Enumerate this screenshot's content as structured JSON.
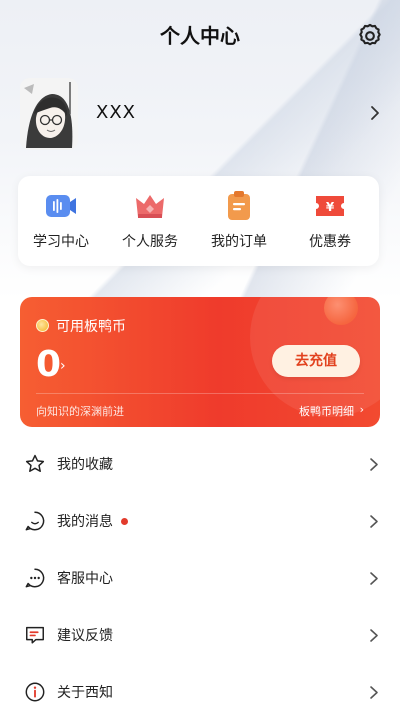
{
  "header": {
    "title": "个人中心",
    "settings_icon": "gear-icon"
  },
  "profile": {
    "username": "XXX",
    "avatar": "avatar-illustration"
  },
  "quick_actions": [
    {
      "label": "学习中心",
      "icon": "video-camera-icon",
      "color": "#5a8df0"
    },
    {
      "label": "个人服务",
      "icon": "crown-icon",
      "color": "#ec6a6a"
    },
    {
      "label": "我的订单",
      "icon": "clipboard-icon",
      "color": "#f29a4c"
    },
    {
      "label": "优惠券",
      "icon": "coupon-icon",
      "color": "#ef4a3a"
    }
  ],
  "coin_card": {
    "label": "可用板鸭币",
    "balance": "0",
    "recharge_button": "去充值",
    "slogan": "向知识的深渊前进",
    "detail_link": "板鸭币明细",
    "accent_color": "#ef3b2c"
  },
  "menu": [
    {
      "label": "我的收藏",
      "icon": "star-icon",
      "has_badge": false
    },
    {
      "label": "我的消息",
      "icon": "message-smile-icon",
      "has_badge": true
    },
    {
      "label": "客服中心",
      "icon": "chat-bubble-dots-icon",
      "has_badge": false
    },
    {
      "label": "建议反馈",
      "icon": "feedback-icon",
      "has_badge": false
    },
    {
      "label": "关于西知",
      "icon": "info-icon",
      "has_badge": false
    }
  ]
}
